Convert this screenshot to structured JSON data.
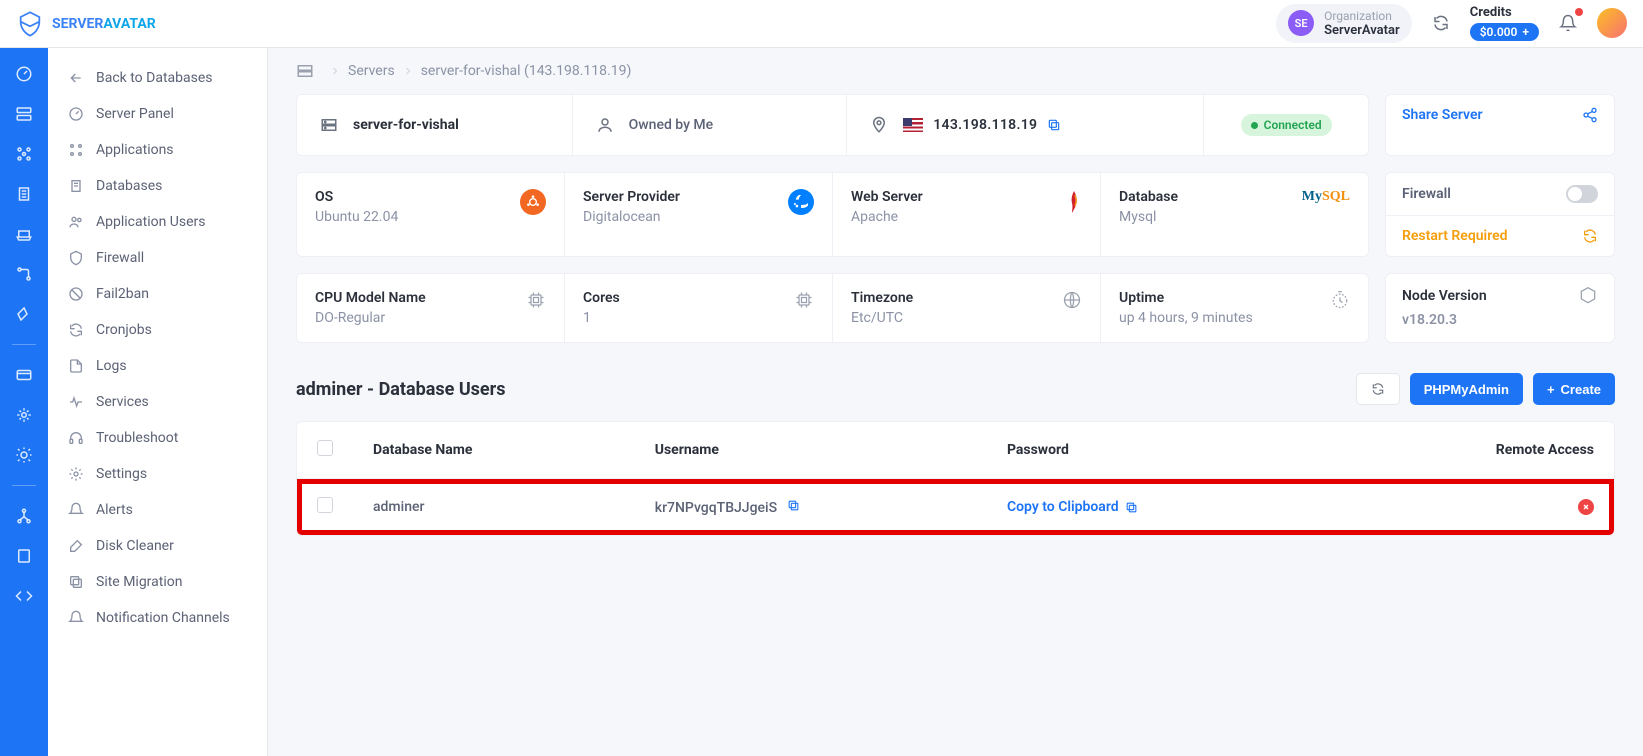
{
  "brand": {
    "name_prefix": "SERVER",
    "name_suffix": "AVATAR"
  },
  "organization": {
    "initials": "SE",
    "label": "Organization",
    "name": "ServerAvatar"
  },
  "credits": {
    "label": "Credits",
    "amount": "$0.000"
  },
  "breadcrumb": {
    "servers": "Servers",
    "current": "server-for-vishal (143.198.118.19)"
  },
  "sidebar": [
    {
      "label": "Back to Databases",
      "icon": "arrow-left"
    },
    {
      "label": "Server Panel",
      "icon": "gauge"
    },
    {
      "label": "Applications",
      "icon": "apps"
    },
    {
      "label": "Databases",
      "icon": "db"
    },
    {
      "label": "Application Users",
      "icon": "users"
    },
    {
      "label": "Firewall",
      "icon": "shield"
    },
    {
      "label": "Fail2ban",
      "icon": "ban"
    },
    {
      "label": "Cronjobs",
      "icon": "refresh"
    },
    {
      "label": "Logs",
      "icon": "file"
    },
    {
      "label": "Services",
      "icon": "heart"
    },
    {
      "label": "Troubleshoot",
      "icon": "headset"
    },
    {
      "label": "Settings",
      "icon": "gear"
    },
    {
      "label": "Alerts",
      "icon": "bell"
    },
    {
      "label": "Disk Cleaner",
      "icon": "brush"
    },
    {
      "label": "Site Migration",
      "icon": "clone"
    },
    {
      "label": "Notification Channels",
      "icon": "bell"
    }
  ],
  "server_header": {
    "name": "server-for-vishal",
    "ownership": "Owned by Me",
    "ip": "143.198.118.19",
    "status": "Connected"
  },
  "info": {
    "os": {
      "label": "OS",
      "value": "Ubuntu 22.04"
    },
    "provider": {
      "label": "Server Provider",
      "value": "Digitalocean"
    },
    "web": {
      "label": "Web Server",
      "value": "Apache"
    },
    "db": {
      "label": "Database",
      "value": "Mysql"
    }
  },
  "info2": {
    "cpu": {
      "label": "CPU Model Name",
      "value": "DO-Regular"
    },
    "cores": {
      "label": "Cores",
      "value": "1"
    },
    "tz": {
      "label": "Timezone",
      "value": "Etc/UTC"
    },
    "uptime": {
      "label": "Uptime",
      "value": "up 4 hours, 9 minutes"
    },
    "node": {
      "label": "Node Version",
      "value": "v18.20.3"
    }
  },
  "sidecards": {
    "share": "Share Server",
    "firewall": "Firewall",
    "restart": "Restart Required"
  },
  "section": {
    "title": "adminer - Database Users",
    "phpmyadmin": "PHPMyAdmin",
    "create": "Create"
  },
  "table": {
    "headers": {
      "db": "Database Name",
      "user": "Username",
      "pw": "Password",
      "remote": "Remote Access"
    },
    "rows": [
      {
        "db": "adminer",
        "user": "kr7NPvgqTBJJgeiS",
        "pw_action": "Copy to Clipboard"
      }
    ]
  }
}
